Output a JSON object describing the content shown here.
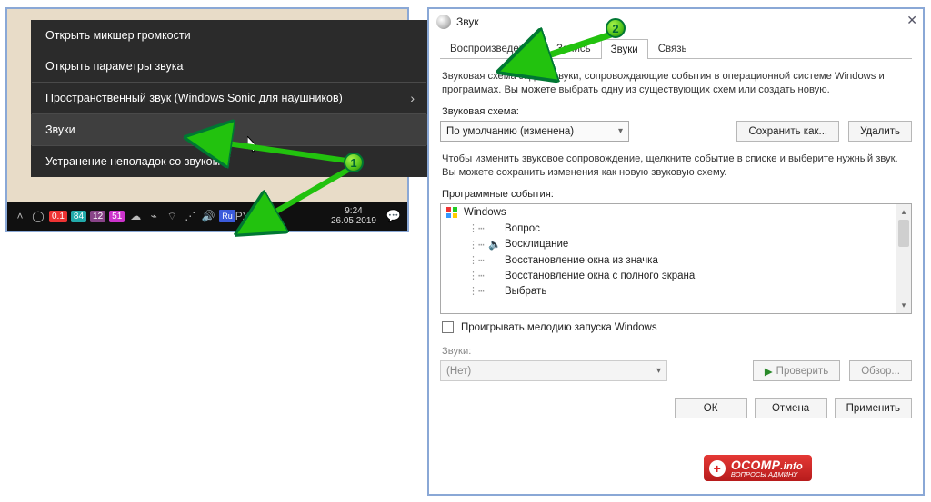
{
  "annotations": {
    "step1": "1",
    "step2": "2"
  },
  "context_menu": {
    "item1": "Открыть микшер громкости",
    "item2": "Открыть параметры звука",
    "item3": "Пространственный звук (Windows Sonic для наушников)",
    "item4": "Звуки",
    "item5": "Устранение неполадок со звуком"
  },
  "taskbar": {
    "badge1": "0.1",
    "badge2": "84",
    "badge3": "12",
    "badge4": "51",
    "lang_ind": "Ru",
    "lang_text": "РУС",
    "time": "9:24",
    "date": "26.05.2019"
  },
  "dialog": {
    "title": "Звук",
    "tabs": {
      "t1": "Воспроизведение",
      "t2": "Запись",
      "t3": "Звуки",
      "t4": "Связь"
    },
    "desc": "Звуковая схема задает звуки, сопровождающие события в операционной системе Windows и программах. Вы можете выбрать одну из существующих схем или создать новую.",
    "scheme_label": "Звуковая схема:",
    "scheme_value": "По умолчанию (изменена)",
    "save_as": "Сохранить как...",
    "delete": "Удалить",
    "events_desc": "Чтобы изменить звуковое сопровождение, щелкните событие в списке и выберите нужный звук. Вы можете сохранить изменения как новую звуковую схему.",
    "events_label": "Программные события:",
    "events": {
      "root": "Windows",
      "e1": "Вопрос",
      "e2": "Восклицание",
      "e3": "Восстановление окна из значка",
      "e4": "Восстановление окна с полного экрана",
      "e5": "Выбрать"
    },
    "play_startup": "Проигрывать мелодию запуска Windows",
    "sounds_label": "Звуки:",
    "sounds_value": "(Нет)",
    "test": "Проверить",
    "browse": "Обзор...",
    "ok": "ОК",
    "cancel": "Отмена",
    "apply": "Применить"
  },
  "watermark": {
    "name": "OCOMP",
    "tld": ".info",
    "sub": "ВОПРОСЫ АДМИНУ"
  }
}
